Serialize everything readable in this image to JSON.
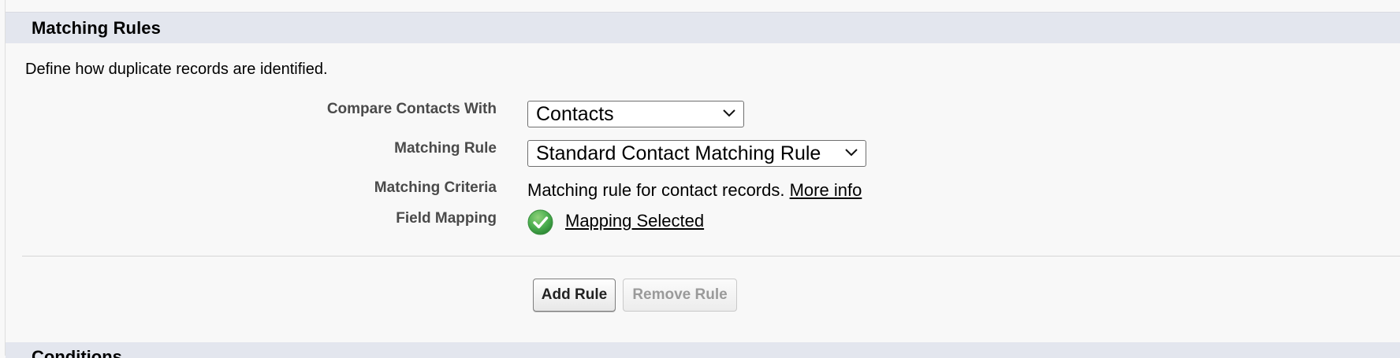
{
  "section": {
    "title": "Matching Rules",
    "description": "Define how duplicate records are identified."
  },
  "fields": {
    "compare_with": {
      "label": "Compare Contacts With",
      "value": "Contacts"
    },
    "matching_rule": {
      "label": "Matching Rule",
      "value": "Standard Contact Matching Rule"
    },
    "matching_criteria": {
      "label": "Matching Criteria",
      "text": "Matching rule for contact records.",
      "link": "More info"
    },
    "field_mapping": {
      "label": "Field Mapping",
      "icon": "check-circle-icon",
      "link": "Mapping Selected",
      "icon_color": "#4caf50"
    }
  },
  "buttons": {
    "add_rule": "Add Rule",
    "remove_rule": "Remove Rule"
  },
  "next_section": {
    "title": "Conditions"
  }
}
